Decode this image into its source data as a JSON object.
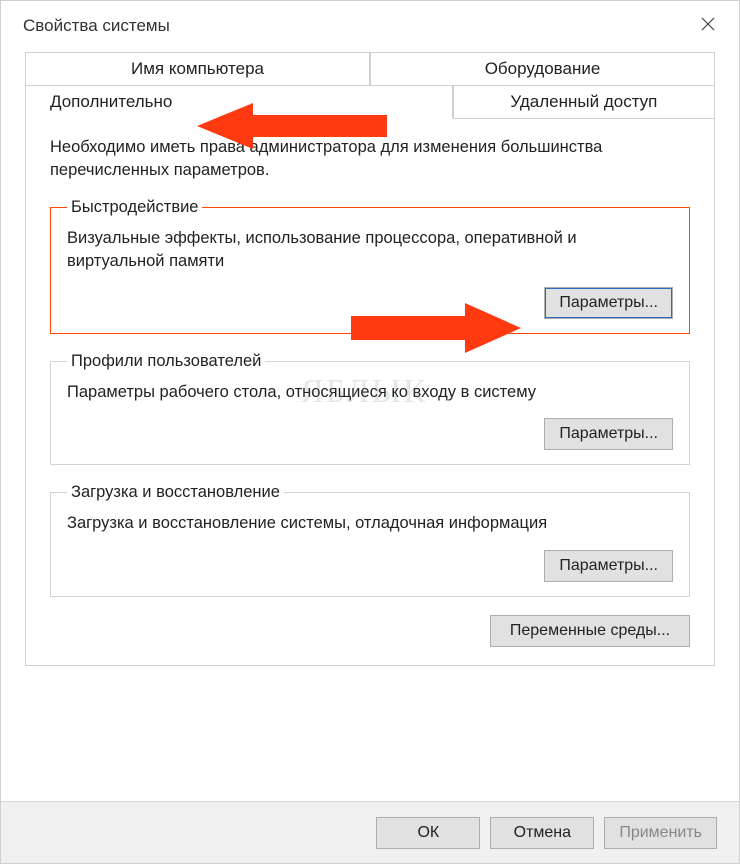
{
  "window": {
    "title": "Свойства системы"
  },
  "tabs": {
    "computer_name": "Имя компьютера",
    "hardware": "Оборудование",
    "advanced": "Дополнительно",
    "remote": "Удаленный доступ"
  },
  "panel": {
    "admin_notice": "Необходимо иметь права администратора для изменения большинства перечисленных параметров."
  },
  "groups": {
    "performance": {
      "legend": "Быстродействие",
      "desc": "Визуальные эффекты, использование процессора, оперативной и виртуальной памяти",
      "button": "Параметры..."
    },
    "profiles": {
      "legend": "Профили пользователей",
      "desc": "Параметры рабочего стола, относящиеся ко входу в систему",
      "button": "Параметры..."
    },
    "startup": {
      "legend": "Загрузка и восстановление",
      "desc": "Загрузка и восстановление системы, отладочная информация",
      "button": "Параметры..."
    },
    "env": {
      "button": "Переменные среды..."
    }
  },
  "footer": {
    "ok": "ОК",
    "cancel": "Отмена",
    "apply": "Применить"
  },
  "watermark": "ЯБЛЫК",
  "annotations": {
    "arrow_color": "#ff3a10"
  }
}
